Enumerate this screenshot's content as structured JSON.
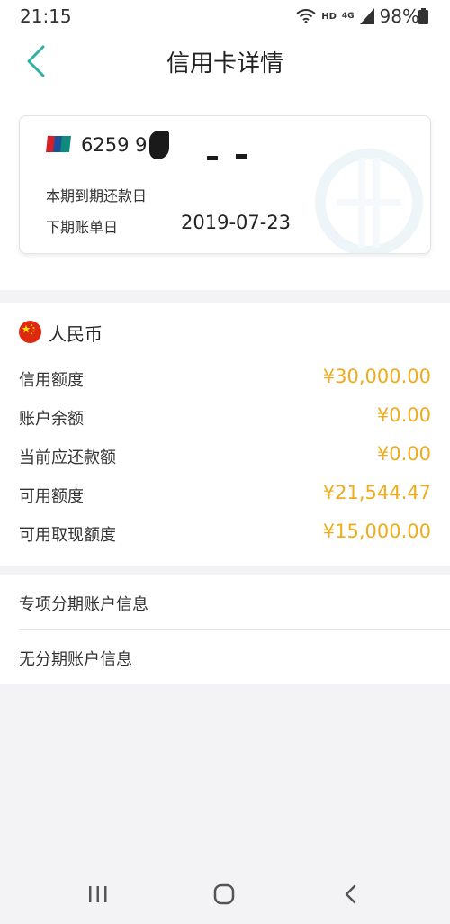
{
  "status_bar": {
    "time": "21:15",
    "hd": "HD",
    "network": "4G",
    "battery": "98%"
  },
  "header": {
    "title": "信用卡详情"
  },
  "card": {
    "number_prefix": "6259 9",
    "due_label": "本期到期还款日",
    "bill_label": "下期账单日",
    "bill_date": "2019-07-23"
  },
  "currency": {
    "name": "人民币",
    "rows": [
      {
        "label": "信用额度",
        "value": "¥30,000.00"
      },
      {
        "label": "账户余额",
        "value": "¥0.00"
      },
      {
        "label": "当前应还款额",
        "value": "¥0.00"
      },
      {
        "label": "可用额度",
        "value": "¥21,544.47"
      },
      {
        "label": "可用取现额度",
        "value": "¥15,000.00"
      }
    ]
  },
  "installments": {
    "items": [
      {
        "label": "专项分期账户信息"
      },
      {
        "label": "无分期账户信息"
      }
    ]
  },
  "colors": {
    "accent": "#2bb3a3",
    "amount": "#f0ab1d",
    "background": "#f3f2f5"
  },
  "icons": {
    "back": "chevron-left-icon",
    "flag": "china-flag-icon",
    "card_brand": "unionpay-logo",
    "nav_recent": "recent-apps-icon",
    "nav_home": "home-icon",
    "nav_back": "back-icon"
  }
}
